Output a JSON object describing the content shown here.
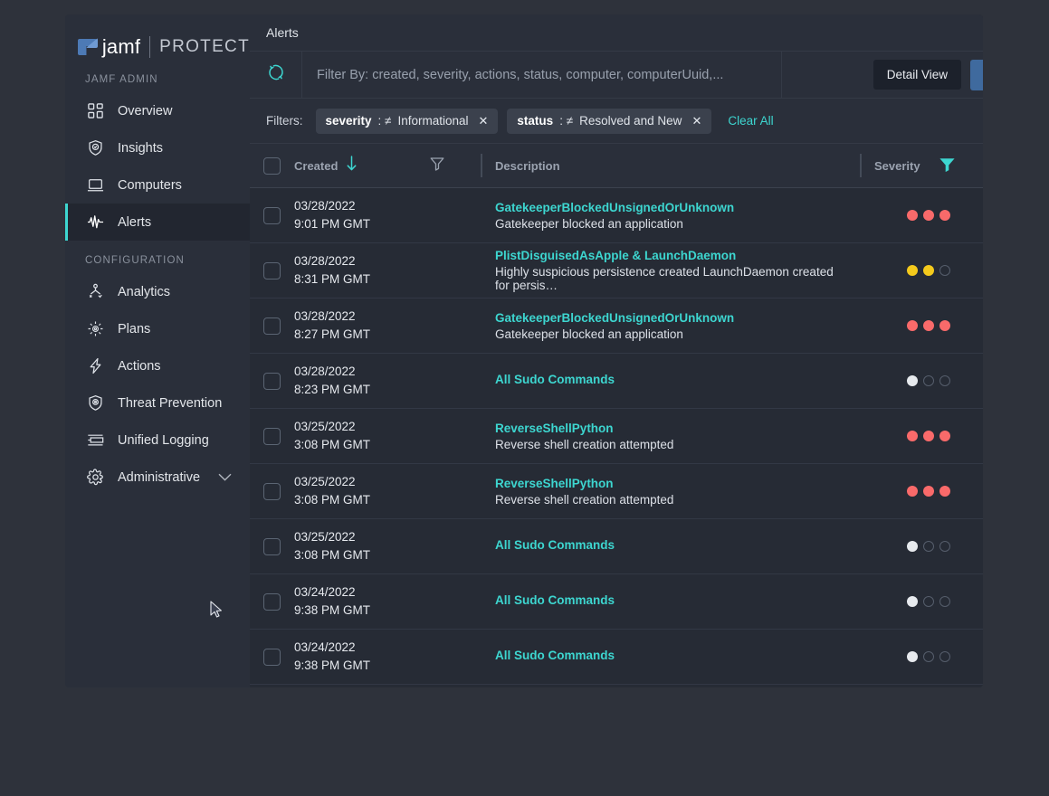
{
  "brand": {
    "name": "jamf",
    "product": "PROTECT"
  },
  "sidebar": {
    "group_admin_label": "JAMF ADMIN",
    "group_config_label": "CONFIGURATION",
    "admin_items": [
      {
        "label": "Overview",
        "icon": "grid-icon"
      },
      {
        "label": "Insights",
        "icon": "shield-check-icon"
      },
      {
        "label": "Computers",
        "icon": "laptop-icon"
      },
      {
        "label": "Alerts",
        "icon": "pulse-icon",
        "active": true
      }
    ],
    "config_items": [
      {
        "label": "Analytics",
        "icon": "analytics-icon"
      },
      {
        "label": "Plans",
        "icon": "gear-sun-icon"
      },
      {
        "label": "Actions",
        "icon": "lightning-icon"
      },
      {
        "label": "Threat Prevention",
        "icon": "shield-target-icon"
      },
      {
        "label": "Unified Logging",
        "icon": "logs-icon"
      },
      {
        "label": "Administrative",
        "icon": "gear-icon",
        "expandable": true
      }
    ]
  },
  "header": {
    "title": "Alerts"
  },
  "toolbar": {
    "refresh_icon": "refresh-icon",
    "filter_placeholder": "Filter By: created, severity, actions, status, computer, computerUuid,...",
    "detail_view_label": "Detail View"
  },
  "filters": {
    "label": "Filters:",
    "chips": [
      {
        "key": "severity",
        "operator": ":  ≠",
        "value": "Informational"
      },
      {
        "key": "status",
        "operator": ":  ≠",
        "value": "Resolved and New"
      }
    ],
    "clear_all_label": "Clear All"
  },
  "table": {
    "columns": {
      "created": "Created",
      "description": "Description",
      "severity": "Severity"
    },
    "sort_icon": "arrow-down-icon",
    "filter_icon": "funnel-icon",
    "rows": [
      {
        "date": "03/28/2022",
        "time": "9:01 PM GMT",
        "title": "GatekeeperBlockedUnsignedOrUnknown",
        "description": "Gatekeeper blocked an application",
        "severity": [
          "red",
          "red",
          "red"
        ]
      },
      {
        "date": "03/28/2022",
        "time": "8:31 PM GMT",
        "title": "PlistDisguisedAsApple & LaunchDaemon",
        "description": "Highly suspicious persistence created LaunchDaemon created for persis…",
        "severity": [
          "yellow",
          "yellow",
          "empty"
        ]
      },
      {
        "date": "03/28/2022",
        "time": "8:27 PM GMT",
        "title": "GatekeeperBlockedUnsignedOrUnknown",
        "description": "Gatekeeper blocked an application",
        "severity": [
          "red",
          "red",
          "red"
        ]
      },
      {
        "date": "03/28/2022",
        "time": "8:23 PM GMT",
        "title": "All Sudo Commands",
        "description": "",
        "severity": [
          "white",
          "empty",
          "empty"
        ]
      },
      {
        "date": "03/25/2022",
        "time": "3:08 PM GMT",
        "title": "ReverseShellPython",
        "description": "Reverse shell creation attempted",
        "severity": [
          "red",
          "red",
          "red"
        ]
      },
      {
        "date": "03/25/2022",
        "time": "3:08 PM GMT",
        "title": "ReverseShellPython",
        "description": "Reverse shell creation attempted",
        "severity": [
          "red",
          "red",
          "red"
        ]
      },
      {
        "date": "03/25/2022",
        "time": "3:08 PM GMT",
        "title": "All Sudo Commands",
        "description": "",
        "severity": [
          "white",
          "empty",
          "empty"
        ]
      },
      {
        "date": "03/24/2022",
        "time": "9:38 PM GMT",
        "title": "All Sudo Commands",
        "description": "",
        "severity": [
          "white",
          "empty",
          "empty"
        ]
      },
      {
        "date": "03/24/2022",
        "time": "9:38 PM GMT",
        "title": "All Sudo Commands",
        "description": "",
        "severity": [
          "white",
          "empty",
          "empty"
        ]
      }
    ]
  },
  "colors": {
    "accent": "#3dd6d0",
    "severity_high": "#f96a6a",
    "severity_medium": "#f4ca1c",
    "severity_low": "#e7eaee",
    "page_bg": "#2e323b",
    "panel_bg": "#262b35",
    "sidebar_bg": "#2a2f3a",
    "primary_button": "#3f6a9e"
  }
}
